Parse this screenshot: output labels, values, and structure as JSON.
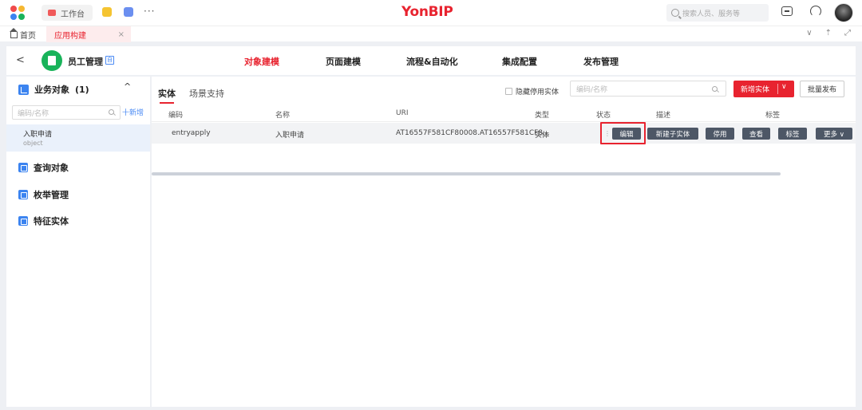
{
  "topbar": {
    "workbench_label": "工作台",
    "more_label": "···",
    "logo_text": "YonBIP",
    "search_placeholder": "搜索人员、服务等",
    "brand_color": "#e8232f"
  },
  "tabs": {
    "home_label": "首页",
    "active_label": "应用构建",
    "close_label": "×"
  },
  "app_header": {
    "back_label": "<",
    "app_name": "员工管理",
    "app_tag": "自",
    "nav": [
      "对象建模",
      "页面建模",
      "流程&自动化",
      "集成配置",
      "发布管理"
    ],
    "active_nav": "对象建模"
  },
  "sidebar": {
    "section_title": "业务对象",
    "section_count": "(1)",
    "collapse_label": "^",
    "search_placeholder": "编码/名称",
    "add_label": "十新增",
    "item": {
      "title": "入职申请",
      "subtitle": "object"
    },
    "sections": [
      "查询对象",
      "枚举管理",
      "特征实体"
    ]
  },
  "main": {
    "tabs": [
      "实体",
      "场景支持"
    ],
    "hide_disabled_label": "隐藏停用实体",
    "search_placeholder": "编码/名称",
    "new_entity_label": "新增实体",
    "new_entity_chevron": "∨",
    "batch_publish_label": "批量发布",
    "columns": [
      "编码",
      "名称",
      "URI",
      "类型",
      "状态",
      "描述",
      "标签"
    ],
    "row": {
      "code": "entryapply",
      "name": "入职申请",
      "uri": "AT16557F581CF80008.AT16557F581CF8...",
      "type": "实体",
      "handle": "⋮"
    },
    "row_actions": [
      "编辑",
      "新建子实体",
      "停用",
      "查看",
      "标签",
      "更多 ∨"
    ]
  }
}
